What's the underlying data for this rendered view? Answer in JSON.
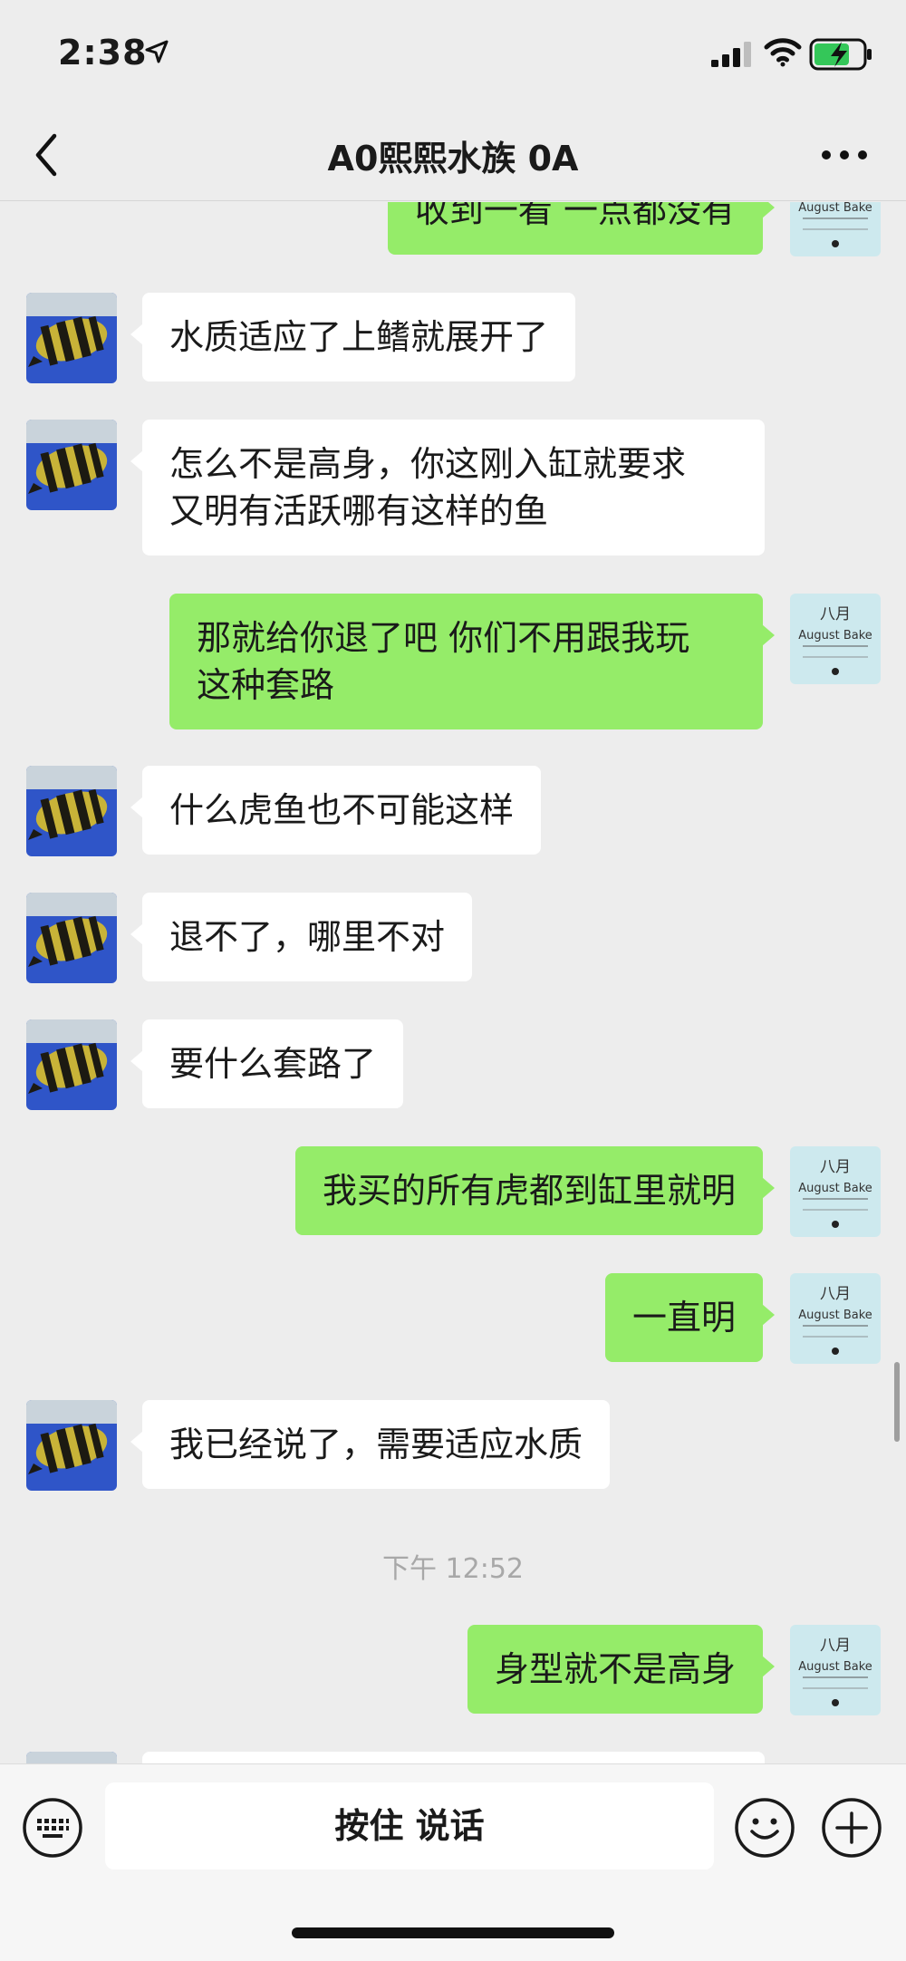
{
  "status_bar": {
    "time": "2:38"
  },
  "nav": {
    "title": "A0熙熙水族 0A"
  },
  "my_avatar_text": {
    "line1": "八月",
    "line2": "August Bake"
  },
  "messages": [
    {
      "side": "out",
      "text": "收到一看 一点都没有"
    },
    {
      "side": "in",
      "text": "水质适应了上鳍就展开了"
    },
    {
      "side": "in",
      "text": "怎么不是高身，你这刚入缸就要求\n又明有活跃哪有这样的鱼"
    },
    {
      "side": "out",
      "text": "那就给你退了吧 你们不用跟我玩\n这种套路"
    },
    {
      "side": "in",
      "text": "什么虎鱼也不可能这样"
    },
    {
      "side": "in",
      "text": "退不了，哪里不对"
    },
    {
      "side": "in",
      "text": "要什么套路了"
    },
    {
      "side": "out",
      "text": "我买的所有虎都到缸里就明"
    },
    {
      "side": "out",
      "text": "一直明"
    },
    {
      "side": "in",
      "text": "我已经说了，需要适应水质"
    },
    {
      "side": "out",
      "text": "身型就不是高身"
    },
    {
      "side": "in",
      "text": ""
    }
  ],
  "timestamp": "下午 12:52",
  "input_bar": {
    "talk_label": "按住 说话"
  },
  "colors": {
    "outgoing_bubble": "#95ec69",
    "incoming_bubble": "#ffffff",
    "background": "#ededed"
  },
  "icons": {
    "location": "location-arrow-icon",
    "signal": "cellular-signal-icon",
    "wifi": "wifi-icon",
    "battery": "battery-charging-icon",
    "back": "chevron-left-icon",
    "more": "more-dots-icon",
    "keyboard": "keyboard-icon",
    "emoji": "emoji-icon",
    "plus": "plus-icon"
  }
}
